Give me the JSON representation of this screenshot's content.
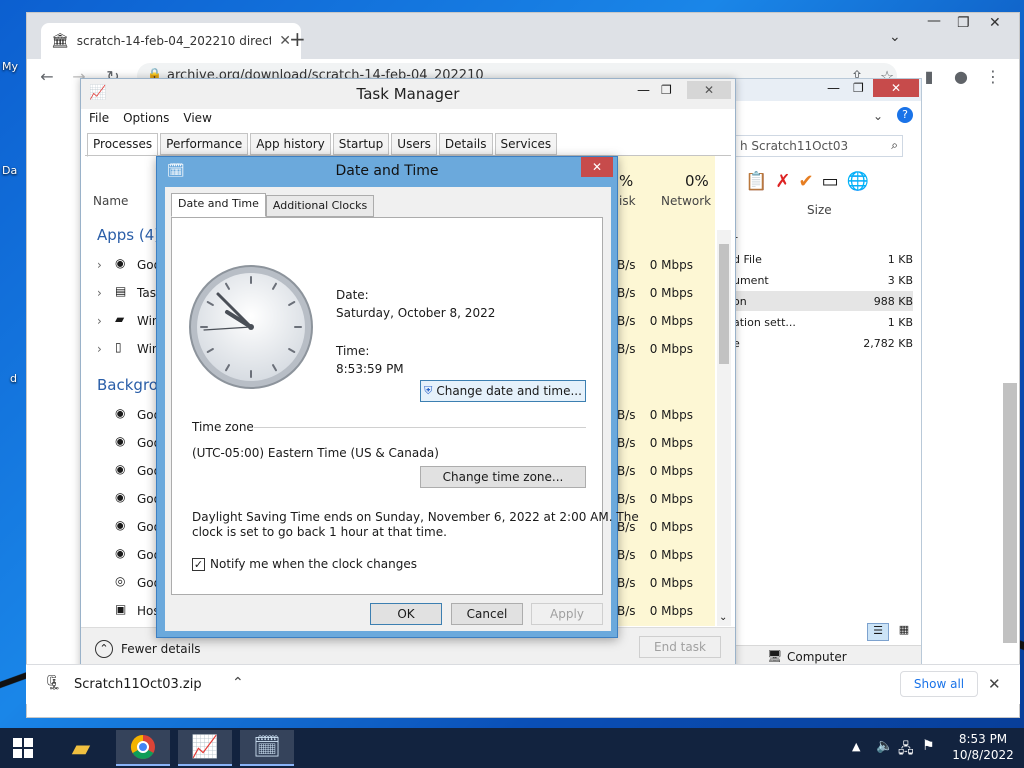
{
  "desktop": {
    "labels": [
      "My",
      "Da",
      "d"
    ]
  },
  "browser": {
    "tab_title": "scratch-14-feb-04_202210 direct",
    "url": "archive.org/download/scratch-14-feb-04_202210",
    "download_file": "Scratch11Oct03.zip",
    "show_all_label": "Show all"
  },
  "explorer": {
    "search_placeholder": "h Scratch11Oct03",
    "size_header": "Size",
    "rows": [
      {
        "name": "r",
        "size": ""
      },
      {
        "name": "d File",
        "size": "1 KB"
      },
      {
        "name": "ument",
        "size": "3 KB"
      },
      {
        "name": "on",
        "size": "988 KB"
      },
      {
        "name": "ation sett...",
        "size": "1 KB"
      },
      {
        "name": "e",
        "size": "2,782 KB"
      }
    ],
    "computer_label": "Computer"
  },
  "task_manager": {
    "title": "Task Manager",
    "menu": [
      "File",
      "Options",
      "View"
    ],
    "tabs": [
      "Processes",
      "Performance",
      "App history",
      "Startup",
      "Users",
      "Details",
      "Services"
    ],
    "name_header": "Name",
    "disk_pct": "%",
    "disk_label": "isk",
    "network_pct": "0%",
    "network_label": "Network",
    "apps_group": "Apps (4)",
    "background_group": "Backgrou",
    "app_rows": [
      {
        "name": "Goo",
        "disk": "B/s",
        "net": "0 Mbps"
      },
      {
        "name": "Tas",
        "disk": "B/s",
        "net": "0 Mbps"
      },
      {
        "name": "Win",
        "disk": "B/s",
        "net": "0 Mbps"
      },
      {
        "name": "Win",
        "disk": "B/s",
        "net": "0 Mbps"
      }
    ],
    "bg_rows": [
      {
        "name": "Goo",
        "disk": "B/s",
        "net": "0 Mbps"
      },
      {
        "name": "Goo",
        "disk": "B/s",
        "net": "0 Mbps"
      },
      {
        "name": "Goo",
        "disk": "B/s",
        "net": "0 Mbps"
      },
      {
        "name": "Goo",
        "disk": "B/s",
        "net": "0 Mbps"
      },
      {
        "name": "Goo",
        "disk": "B/s",
        "net": "0 Mbps"
      },
      {
        "name": "Goo",
        "disk": "B/s",
        "net": "0 Mbps"
      },
      {
        "name": "Goo",
        "disk": "B/s",
        "net": "0 Mbps"
      },
      {
        "name": "Hos",
        "disk": "B/s",
        "net": "0 Mbps"
      }
    ],
    "fewer_details": "Fewer details",
    "end_task": "End task"
  },
  "date_time": {
    "title": "Date and Time",
    "tabs": [
      "Date and Time",
      "Additional Clocks"
    ],
    "date_label": "Date:",
    "date_value": "Saturday, October 8, 2022",
    "time_label": "Time:",
    "time_value": "8:53:59 PM",
    "change_datetime_btn": "Change date and time...",
    "timezone_header": "Time zone",
    "timezone_value": "(UTC-05:00) Eastern Time (US & Canada)",
    "change_tz_btn": "Change time zone...",
    "dst_line1": "Daylight Saving Time ends on Sunday, November 6, 2022 at 2:00 AM. The",
    "dst_line2": "clock is set to go back 1 hour at that time.",
    "notify_label": "Notify me when the clock changes",
    "notify_checked": true,
    "ok": "OK",
    "cancel": "Cancel",
    "apply": "Apply"
  },
  "taskbar": {
    "time": "8:53 PM",
    "date": "10/8/2022"
  }
}
